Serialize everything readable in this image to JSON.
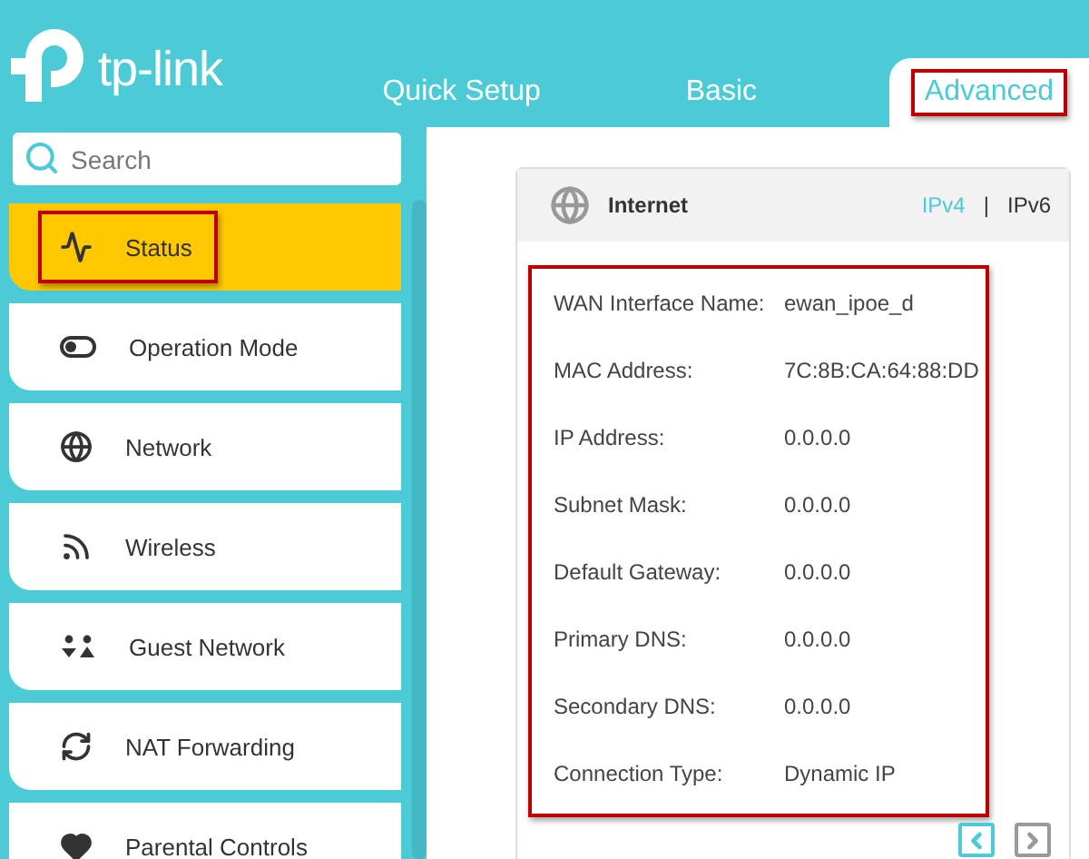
{
  "logo": "tp-link",
  "tabs": [
    {
      "label": "Quick Setup",
      "selected": false,
      "highlighted": false
    },
    {
      "label": "Basic",
      "selected": false,
      "highlighted": false
    },
    {
      "label": "Advanced",
      "selected": true,
      "highlighted": true
    }
  ],
  "search": {
    "placeholder": "Search"
  },
  "sidebar": {
    "items": [
      {
        "label": "Status",
        "kind": "status",
        "selected": true,
        "highlighted": true
      },
      {
        "label": "Operation Mode",
        "kind": "mode",
        "selected": false,
        "highlighted": false
      },
      {
        "label": "Network",
        "kind": "network",
        "selected": false,
        "highlighted": false
      },
      {
        "label": "Wireless",
        "kind": "wireless",
        "selected": false,
        "highlighted": false
      },
      {
        "label": "Guest Network",
        "kind": "guest",
        "selected": false,
        "highlighted": false
      },
      {
        "label": "NAT Forwarding",
        "kind": "nat",
        "selected": false,
        "highlighted": false
      },
      {
        "label": "Parental Controls",
        "kind": "parental",
        "selected": false,
        "highlighted": false
      }
    ]
  },
  "card": {
    "title": "Internet",
    "versions": [
      {
        "label": "IPv4",
        "selected": true
      },
      {
        "label": "IPv6",
        "selected": false
      }
    ],
    "separator": "|",
    "highlighted": true,
    "rows": [
      {
        "label": "WAN Interface Name:",
        "value": "ewan_ipoe_d"
      },
      {
        "label": "MAC Address:",
        "value": "7C:8B:CA:64:88:DD"
      },
      {
        "label": "IP Address:",
        "value": "0.0.0.0"
      },
      {
        "label": "Subnet Mask:",
        "value": "0.0.0.0"
      },
      {
        "label": "Default Gateway:",
        "value": "0.0.0.0"
      },
      {
        "label": "Primary DNS:",
        "value": "0.0.0.0"
      },
      {
        "label": "Secondary DNS:",
        "value": "0.0.0.0"
      },
      {
        "label": "Connection Type:",
        "value": "Dynamic IP"
      }
    ],
    "pager": [
      {
        "kind": "prev",
        "selected": true
      },
      {
        "kind": "next",
        "selected": false
      }
    ]
  }
}
